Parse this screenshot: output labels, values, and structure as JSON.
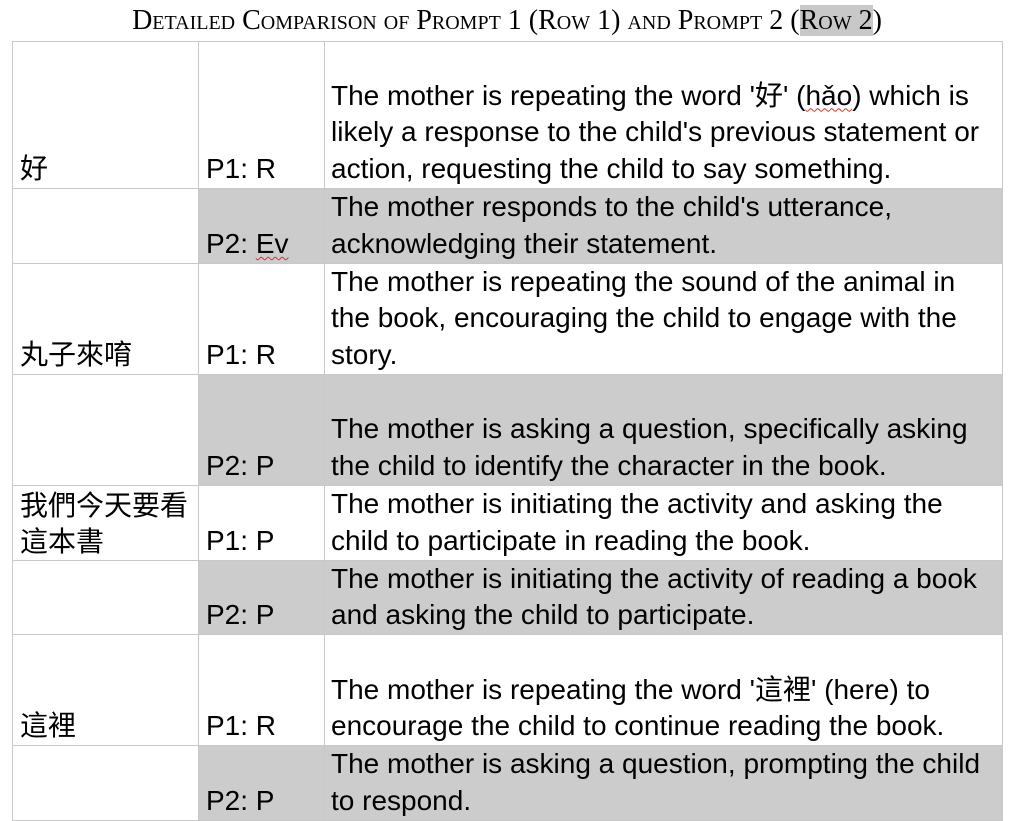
{
  "title": {
    "prefix": "Detailed Comparison of Prompt 1 (Row 1) and Prompt 2 (",
    "highlight": "Row 2",
    "suffix": ")"
  },
  "rows": [
    {
      "word": "好",
      "p1": {
        "code": "P1: R",
        "desc_start": "The mother is repeating the word '好' (",
        "desc_flag": "hǎo",
        "desc_end": ") which is likely a response to the child's previous statement or action, requesting the child to say something."
      },
      "p2": {
        "code_prefix": "P2: ",
        "code_flag": "Ev",
        "desc": "The mother responds to the child's utterance, acknowledging their statement."
      }
    },
    {
      "word": "丸子來唷",
      "p1": {
        "code": "P1: R",
        "desc": "The mother is repeating the sound of the animal in the book, encouraging the child to engage with the story."
      },
      "p2": {
        "code": "P2: P",
        "desc": "The mother is asking a question, specifically asking the child to identify the character in the book."
      }
    },
    {
      "word": "我們今天要看這本書",
      "p1": {
        "code": "P1: P",
        "desc": "The mother is initiating the activity and asking the child to participate in reading the book."
      },
      "p2": {
        "code": "P2: P",
        "desc": "The mother is initiating the activity of reading a book and asking the child to participate."
      }
    },
    {
      "word": "這裡",
      "p1": {
        "code": "P1: R",
        "desc": "The mother is repeating the word '這裡' (here) to encourage the child to continue reading the book."
      },
      "p2": {
        "code": "P2: P",
        "desc": "The mother is asking a question, prompting the child to respond."
      }
    }
  ]
}
